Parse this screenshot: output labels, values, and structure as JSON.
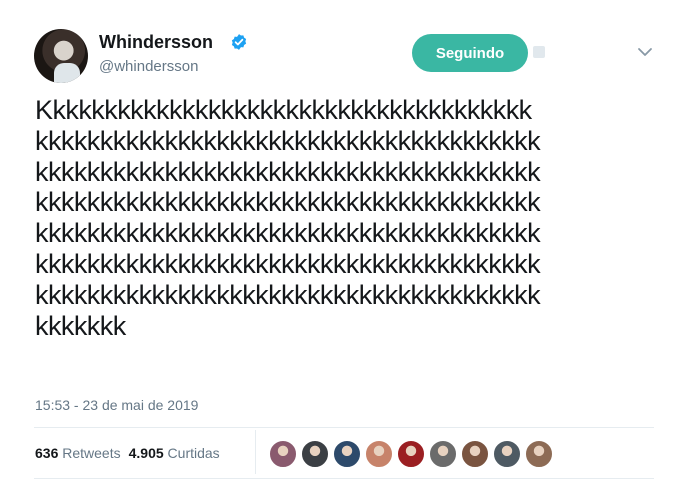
{
  "user": {
    "name": "Whindersson",
    "handle": "@whindersson"
  },
  "follow_button": {
    "label": "Seguindo"
  },
  "tweet": {
    "lines": [
      "Kkkkkkkkkkkkkkkkkkkkkkkkkkkkkkkkkkkkkk",
      "kkkkkkkkkkkkkkkkkkkkkkkkkkkkkkkkkkkkkkk",
      "kkkkkkkkkkkkkkkkkkkkkkkkkkkkkkkkkkkkkkk",
      "kkkkkkkkkkkkkkkkkkkkkkkkkkkkkkkkkkkkkkk",
      "kkkkkkkkkkkkkkkkkkkkkkkkkkkkkkkkkkkkkkk",
      "kkkkkkkkkkkkkkkkkkkkkkkkkkkkkkkkkkkkkkk",
      "kkkkkkkkkkkkkkkkkkkkkkkkkkkkkkkkkkkkkkk",
      "kkkkkkk"
    ],
    "timestamp": "15:53 - 23 de mai de 2019"
  },
  "stats": {
    "retweets_count": "636",
    "retweets_label": "Retweets",
    "likes_count": "4.905",
    "likes_label": "Curtidas"
  },
  "likers": [
    {
      "icon": "liker-avatar-1",
      "color": "#8a5a6e"
    },
    {
      "icon": "liker-avatar-2",
      "color": "#3b3f44"
    },
    {
      "icon": "liker-avatar-3",
      "color": "#2d4a6b"
    },
    {
      "icon": "liker-avatar-4",
      "color": "#c7836a"
    },
    {
      "icon": "liker-avatar-5",
      "color": "#9b1f22"
    },
    {
      "icon": "liker-avatar-6",
      "color": "#6b6b6b"
    },
    {
      "icon": "liker-avatar-7",
      "color": "#7a5440"
    },
    {
      "icon": "liker-avatar-8",
      "color": "#4e5a63"
    },
    {
      "icon": "liker-avatar-9",
      "color": "#8d6b55"
    }
  ],
  "colors": {
    "follow_button_bg": "#3ab7a3",
    "verified_badge": "#1da1f2"
  }
}
